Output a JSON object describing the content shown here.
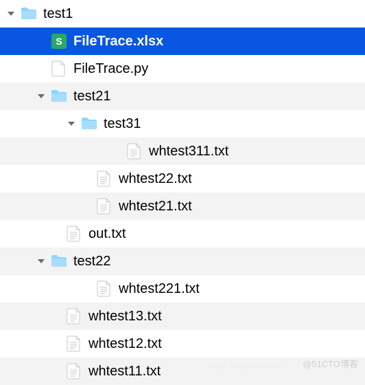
{
  "rows": [
    {
      "indent": 0,
      "disclosure": "down",
      "icon": "folder",
      "label": "test1",
      "selected": false,
      "interactable": true
    },
    {
      "indent": 44,
      "disclosure": "none",
      "icon": "xlsx",
      "label": "FileTrace.xlsx",
      "selected": true,
      "interactable": true
    },
    {
      "indent": 44,
      "disclosure": "none",
      "icon": "blank",
      "label": "FileTrace.py",
      "selected": false,
      "interactable": true
    },
    {
      "indent": 44,
      "disclosure": "down",
      "icon": "folder",
      "label": "test21",
      "selected": false,
      "interactable": true
    },
    {
      "indent": 88,
      "disclosure": "down",
      "icon": "folder",
      "label": "test31",
      "selected": false,
      "interactable": true
    },
    {
      "indent": 154,
      "disclosure": "none",
      "icon": "txt",
      "label": "whtest311.txt",
      "selected": false,
      "interactable": true
    },
    {
      "indent": 110,
      "disclosure": "none",
      "icon": "txt",
      "label": "whtest22.txt",
      "selected": false,
      "interactable": true
    },
    {
      "indent": 110,
      "disclosure": "none",
      "icon": "txt",
      "label": "whtest21.txt",
      "selected": false,
      "interactable": true
    },
    {
      "indent": 66,
      "disclosure": "none",
      "icon": "txt",
      "label": "out.txt",
      "selected": false,
      "interactable": true
    },
    {
      "indent": 44,
      "disclosure": "down",
      "icon": "folder",
      "label": "test22",
      "selected": false,
      "interactable": true
    },
    {
      "indent": 110,
      "disclosure": "none",
      "icon": "txt",
      "label": "whtest221.txt",
      "selected": false,
      "interactable": true
    },
    {
      "indent": 66,
      "disclosure": "none",
      "icon": "txt",
      "label": "whtest13.txt",
      "selected": false,
      "interactable": true
    },
    {
      "indent": 66,
      "disclosure": "none",
      "icon": "txt",
      "label": "whtest12.txt",
      "selected": false,
      "interactable": true
    },
    {
      "indent": 66,
      "disclosure": "none",
      "icon": "txt",
      "label": "whtest11.txt",
      "selected": false,
      "interactable": true
    }
  ],
  "watermark_left": "https://blog.csdn.net",
  "watermark": "@51CTO博客"
}
